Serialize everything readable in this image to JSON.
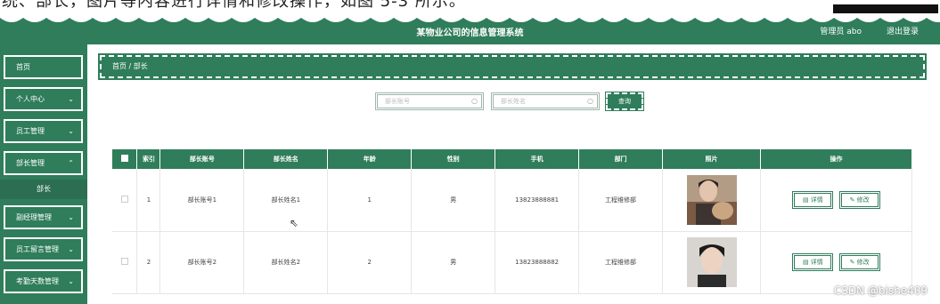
{
  "caption": {
    "text": "统、部长，图片等内容进行详情和修改操作，如图 5-3 所示。"
  },
  "header": {
    "title": "某物业公司的信息管理系统",
    "admin": "管理员 abo",
    "logout": "退出登录"
  },
  "sidebar": {
    "items": [
      {
        "label": "首页",
        "chevron": ""
      },
      {
        "label": "个人中心",
        "chevron": "⌄"
      },
      {
        "label": "员工管理",
        "chevron": "⌄"
      },
      {
        "label": "部长管理",
        "chevron": "⌃"
      },
      {
        "label": "副经理管理",
        "chevron": "⌄"
      },
      {
        "label": "员工留言管理",
        "chevron": "⌄"
      },
      {
        "label": "考勤天数管理",
        "chevron": "⌄"
      }
    ],
    "sub_item": "部长"
  },
  "breadcrumb": {
    "home": "首页",
    "sep": "/",
    "current": "部长"
  },
  "search": {
    "account_placeholder": "部长账号",
    "name_placeholder": "部长姓名",
    "query_label": "查询"
  },
  "table": {
    "headers": [
      "索引",
      "部长账号",
      "部长姓名",
      "年龄",
      "性别",
      "手机",
      "部门",
      "照片",
      "操作"
    ],
    "rows": [
      {
        "index": "1",
        "account": "部长账号1",
        "name": "部长姓名1",
        "age": "1",
        "gender": "男",
        "phone": "13823888881",
        "dept": "工程维修部"
      },
      {
        "index": "2",
        "account": "部长账号2",
        "name": "部长姓名2",
        "age": "2",
        "gender": "男",
        "phone": "13823888882",
        "dept": "工程维修部"
      }
    ],
    "detail_label": "详情",
    "edit_label": "修改"
  },
  "watermark": "CSDN @bishe409",
  "colors": {
    "primary": "#2f7d5b"
  }
}
